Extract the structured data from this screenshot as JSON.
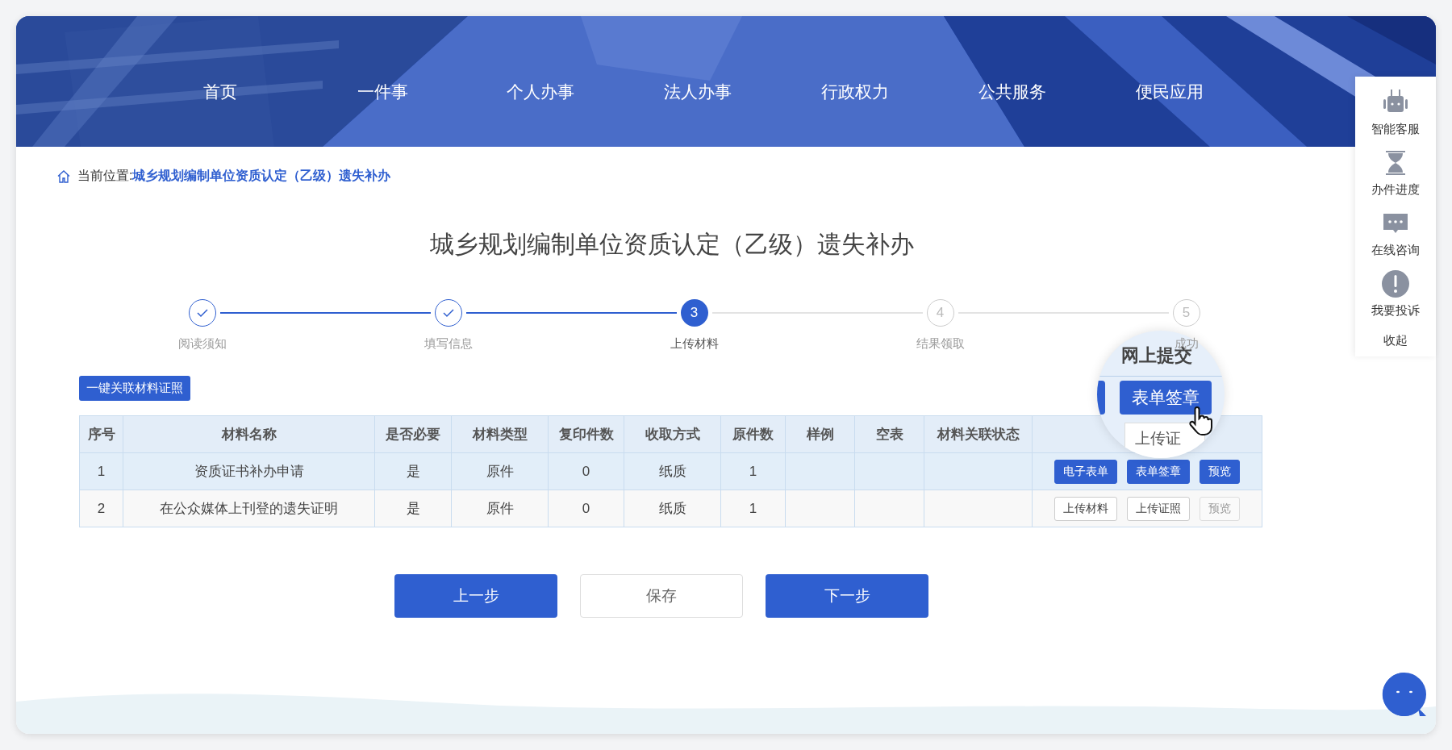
{
  "nav": [
    "首页",
    "一件事",
    "个人办事",
    "法人办事",
    "行政权力",
    "公共服务",
    "便民应用"
  ],
  "breadcrumb": {
    "prefix": "当前位置:",
    "current": "城乡规划编制单位资质认定（乙级）遗失补办"
  },
  "title": "城乡规划编制单位资质认定（乙级）遗失补办",
  "steps": [
    {
      "label": "阅读须知",
      "done": true,
      "active": false
    },
    {
      "label": "填写信息",
      "done": true,
      "active": false
    },
    {
      "number": "3",
      "label": "上传材料",
      "done": false,
      "active": true
    },
    {
      "number": "4",
      "label": "结果领取",
      "done": false,
      "active": false
    },
    {
      "number": "5",
      "label": "成功",
      "done": false,
      "active": false
    }
  ],
  "link_button": "一键关联材料证照",
  "table": {
    "columns": [
      "序号",
      "材料名称",
      "是否必要",
      "材料类型",
      "复印件数",
      "收取方式",
      "原件数",
      "样例",
      "空表",
      "材料关联状态"
    ],
    "rows": [
      {
        "selected": true,
        "cells": [
          "1",
          "资质证书补办申请",
          "是",
          "原件",
          "0",
          "纸质",
          "1"
        ],
        "actions": [
          {
            "label": "电子表单",
            "kind": "primary"
          },
          {
            "label": "表单签章",
            "kind": "primary"
          },
          {
            "label": "预览",
            "kind": "primary"
          }
        ]
      },
      {
        "selected": false,
        "cells": [
          "2",
          "在公众媒体上刊登的遗失证明",
          "是",
          "原件",
          "0",
          "纸质",
          "1"
        ],
        "actions": [
          {
            "label": "上传材料",
            "kind": "default"
          },
          {
            "label": "上传证照",
            "kind": "default"
          },
          {
            "label": "预览",
            "kind": "disabled"
          }
        ]
      }
    ]
  },
  "footer_buttons": [
    {
      "label": "上一步",
      "kind": "primary"
    },
    {
      "label": "保存",
      "kind": "default"
    },
    {
      "label": "下一步",
      "kind": "primary"
    }
  ],
  "side_panel": {
    "items": [
      "智能客服",
      "办件进度",
      "在线咨询",
      "我要投诉"
    ],
    "collapse": "收起"
  },
  "magnifier": {
    "heading": "网上提交",
    "button": "表单签章",
    "partial": "上传证"
  }
}
